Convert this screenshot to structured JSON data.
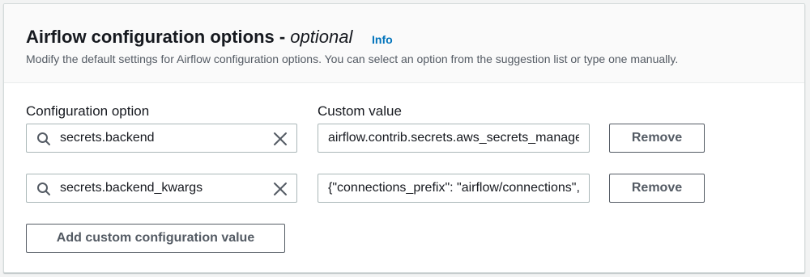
{
  "section": {
    "title": "Airflow configuration options - ",
    "title_optional": "optional",
    "info_link": "Info",
    "description": "Modify the default settings for Airflow configuration options. You can select an option from the suggestion list or type one manually."
  },
  "columns": {
    "option_label": "Configuration option",
    "value_label": "Custom value"
  },
  "rows": [
    {
      "option": "secrets.backend",
      "value": "airflow.contrib.secrets.aws_secrets_manager.SecretsManagerBackend",
      "remove_label": "Remove"
    },
    {
      "option": "secrets.backend_kwargs",
      "value": "{\"connections_prefix\": \"airflow/connections\", \"variables_prefix\": \"airflow/variables\"}",
      "remove_label": "Remove"
    }
  ],
  "add_button_label": "Add custom configuration value",
  "icons": {
    "search": "search-icon",
    "clear": "close-icon"
  },
  "colors": {
    "link": "#0073bb",
    "text": "#16191f",
    "secondary_text": "#545b64",
    "border": "#aab7b8"
  }
}
